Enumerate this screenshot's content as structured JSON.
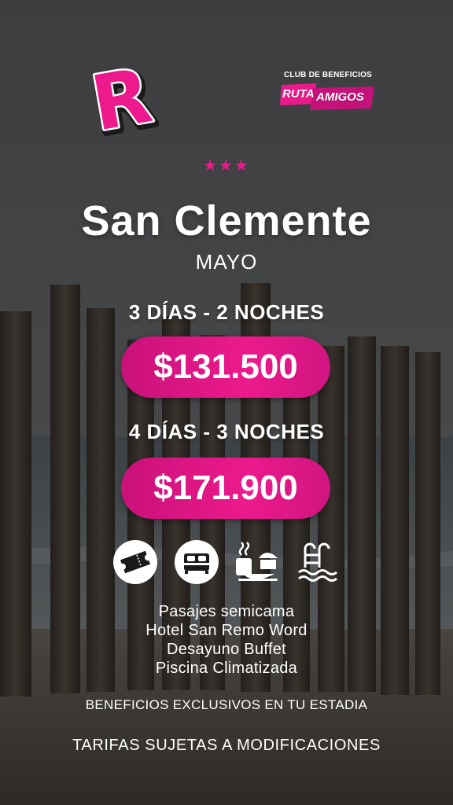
{
  "brand": {
    "logo_letter": "R",
    "club_title": "CLUB DE BENEFICIOS",
    "club_word1": "RUTA",
    "club_word2": "AMIGOS"
  },
  "rating_stars": "★★★",
  "destination": "San Clemente",
  "month": "MAYO",
  "packages": [
    {
      "label": "3 DÍAS - 2 NOCHES",
      "price": "$131.500"
    },
    {
      "label": "4 DÍAS - 3 NOCHES",
      "price": "$171.900"
    }
  ],
  "amenity_icons": [
    "ticket-icon",
    "bed-icon",
    "breakfast-icon",
    "pool-icon"
  ],
  "features": [
    "Pasajes semicama",
    "Hotel San Remo Word",
    "Desayuno Buffet",
    "Piscina Climatizada"
  ],
  "benefits_note": "BENEFICIOS EXCLUSIVOS EN TU ESTADIA",
  "disclaimer": "TARIFAS SUJETAS A MODIFICACIONES",
  "colors": {
    "accent": "#ec1a8c",
    "text": "#ffffff",
    "overlay": "#4a4a4a"
  }
}
